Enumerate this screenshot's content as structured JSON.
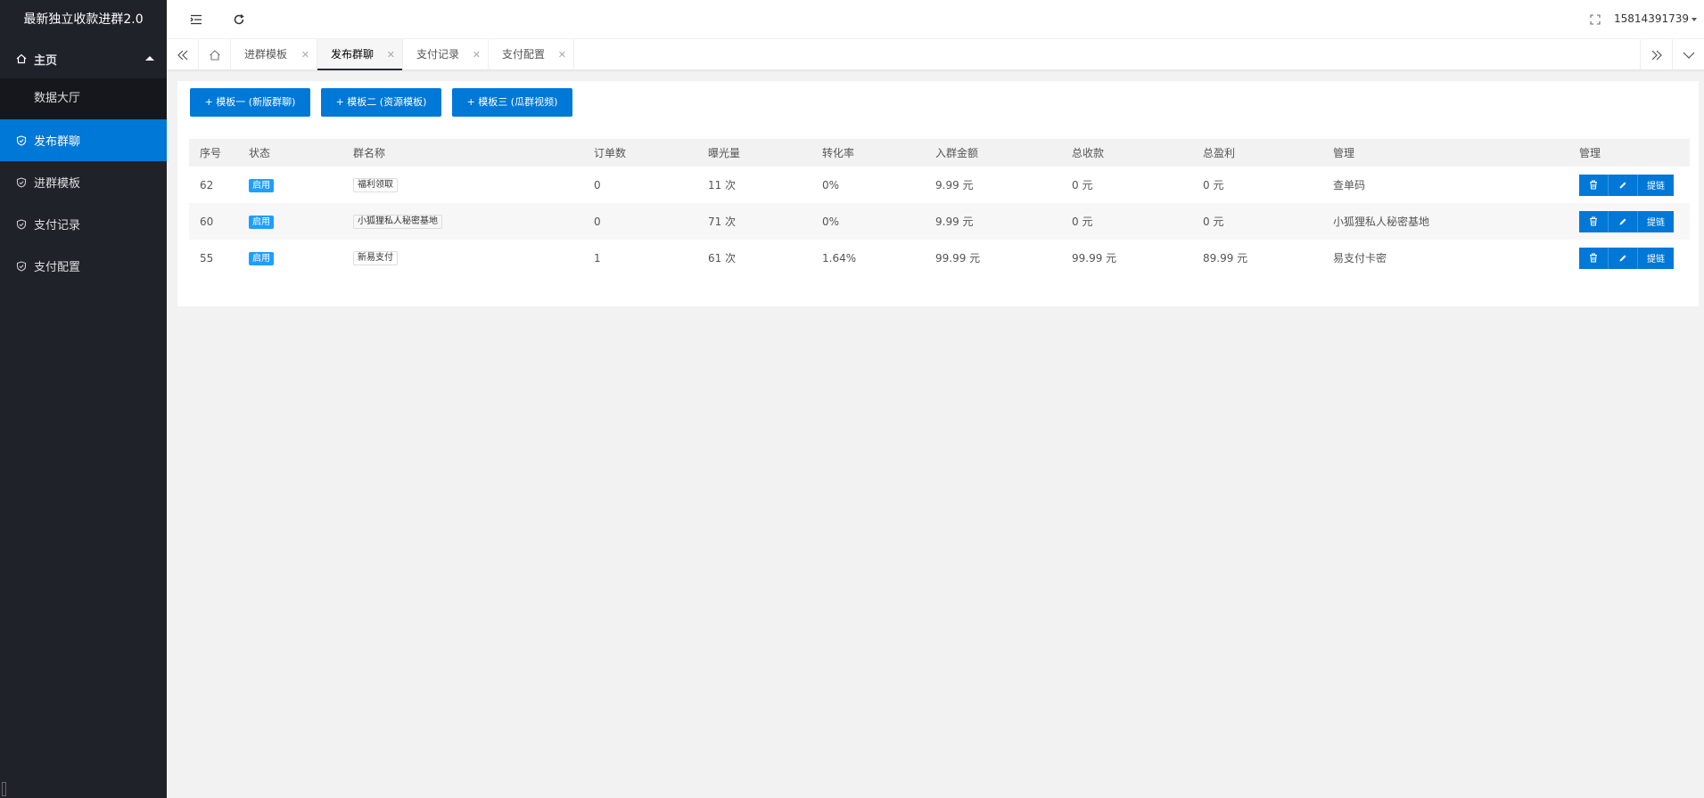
{
  "app": {
    "title": "最新独立收款进群2.0"
  },
  "sidebar": {
    "home_label": "主页",
    "sub_items": [
      {
        "label": "数据大厅"
      }
    ],
    "items": [
      {
        "label": "发布群聊",
        "active": true
      },
      {
        "label": "进群模板",
        "active": false
      },
      {
        "label": "支付记录",
        "active": false
      },
      {
        "label": "支付配置",
        "active": false
      }
    ]
  },
  "header": {
    "user": "15814391739"
  },
  "tabs": [
    {
      "label": "进群模板",
      "active": false
    },
    {
      "label": "发布群聊",
      "active": true
    },
    {
      "label": "支付记录",
      "active": false
    },
    {
      "label": "支付配置",
      "active": false
    }
  ],
  "toolbar": {
    "buttons": [
      {
        "label": "+ 模板一 (新版群聊)"
      },
      {
        "label": "+ 模板二 (资源模板)"
      },
      {
        "label": "+ 模板三 (瓜群视频)"
      }
    ]
  },
  "table": {
    "columns": [
      "序号",
      "状态",
      "群名称",
      "订单数",
      "曝光量",
      "转化率",
      "入群金额",
      "总收款",
      "总盈利",
      "管理",
      "管理"
    ],
    "rows": [
      {
        "id": "62",
        "status": "启用",
        "name": "福利领取",
        "orders": "0",
        "views": "11 次",
        "rate": "0%",
        "price": "9.99 元",
        "total": "0 元",
        "profit": "0 元",
        "manage": "查单码"
      },
      {
        "id": "60",
        "status": "启用",
        "name": "小狐狸私人秘密基地",
        "orders": "0",
        "views": "71 次",
        "rate": "0%",
        "price": "9.99 元",
        "total": "0 元",
        "profit": "0 元",
        "manage": "小狐狸私人秘密基地"
      },
      {
        "id": "55",
        "status": "启用",
        "name": "新易支付",
        "orders": "1",
        "views": "61 次",
        "rate": "1.64%",
        "price": "99.99 元",
        "total": "99.99 元",
        "profit": "89.99 元",
        "manage": "易支付卡密"
      }
    ],
    "op_labels": {
      "delete_icon": "trash-icon",
      "edit_icon": "pencil-icon",
      "withdraw": "提链"
    }
  },
  "colors": {
    "accent": "#0078d7",
    "sidebar": "#20222a",
    "badge": "#1e9fff"
  }
}
